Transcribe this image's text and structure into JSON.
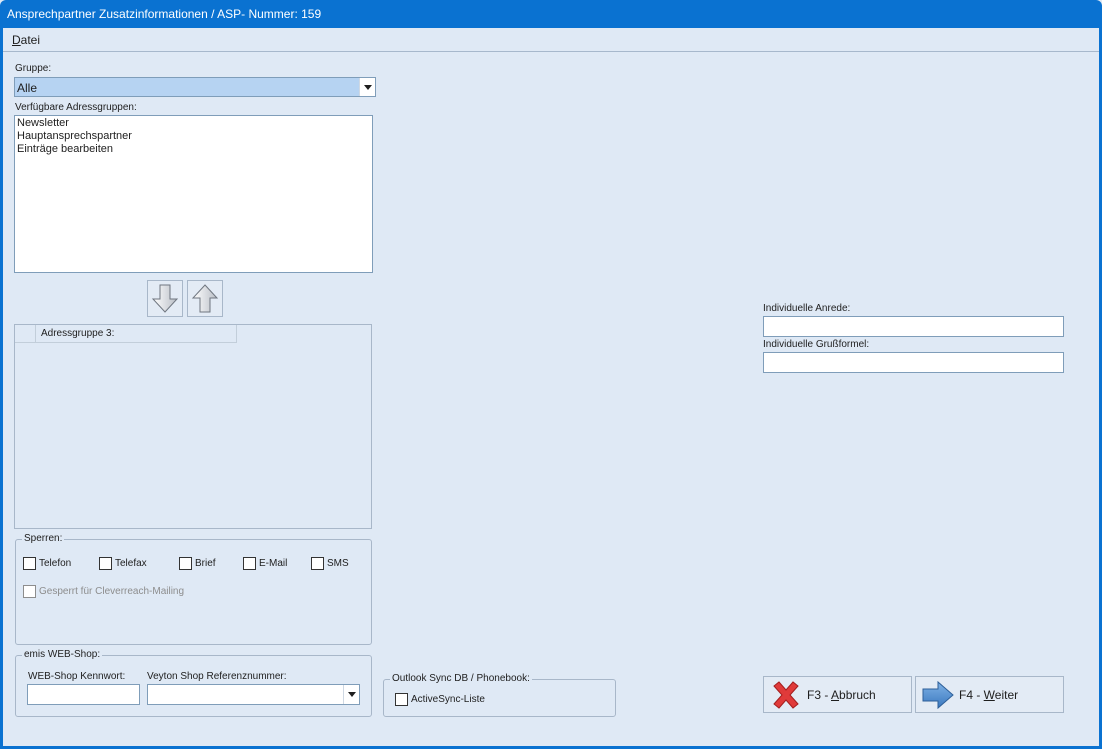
{
  "window": {
    "title": "Ansprechpartner Zusatzinformationen / ASP- Nummer: 159"
  },
  "menu": {
    "file_accel": "D",
    "file_rest": "atei"
  },
  "group": {
    "label": "Gruppe:",
    "value": "Alle"
  },
  "available": {
    "label": "Verfügbare Adressgruppen:",
    "items": [
      "Newsletter",
      "Hauptansprechspartner",
      "Einträge bearbeiten"
    ]
  },
  "grid": {
    "column": "Adressgruppe 3:"
  },
  "sperren": {
    "legend": "Sperren:",
    "telefon": "Telefon",
    "telefax": "Telefax",
    "brief": "Brief",
    "email": "E-Mail",
    "sms": "SMS",
    "cleverreach": "Gesperrt für Cleverreach-Mailing"
  },
  "webshop": {
    "legend": "emis WEB-Shop:",
    "password_label": "WEB-Shop Kennwort:",
    "password_value": "",
    "ref_label": "Veyton Shop Referenznummer:",
    "ref_value": ""
  },
  "outlook": {
    "legend": "Outlook Sync DB / Phonebook:",
    "activesync": "ActiveSync-Liste"
  },
  "salutation": {
    "label": "Individuelle Anrede:",
    "value": ""
  },
  "greeting": {
    "label": "Individuelle Grußformel:",
    "value": ""
  },
  "buttons": {
    "cancel_prefix": "F3 - ",
    "cancel_accel": "A",
    "cancel_rest": "bbruch",
    "next_prefix": "F4 - ",
    "next_accel": "W",
    "next_rest": "eiter"
  },
  "colors": {
    "titlebar": "#0a72d1",
    "window_bg": "#dfe9f5",
    "selection": "#b6d3f2"
  },
  "icons": [
    "arrow-down-icon",
    "arrow-up-icon",
    "cancel-x-icon",
    "arrow-right-icon",
    "dropdown-arrow-icon"
  ]
}
